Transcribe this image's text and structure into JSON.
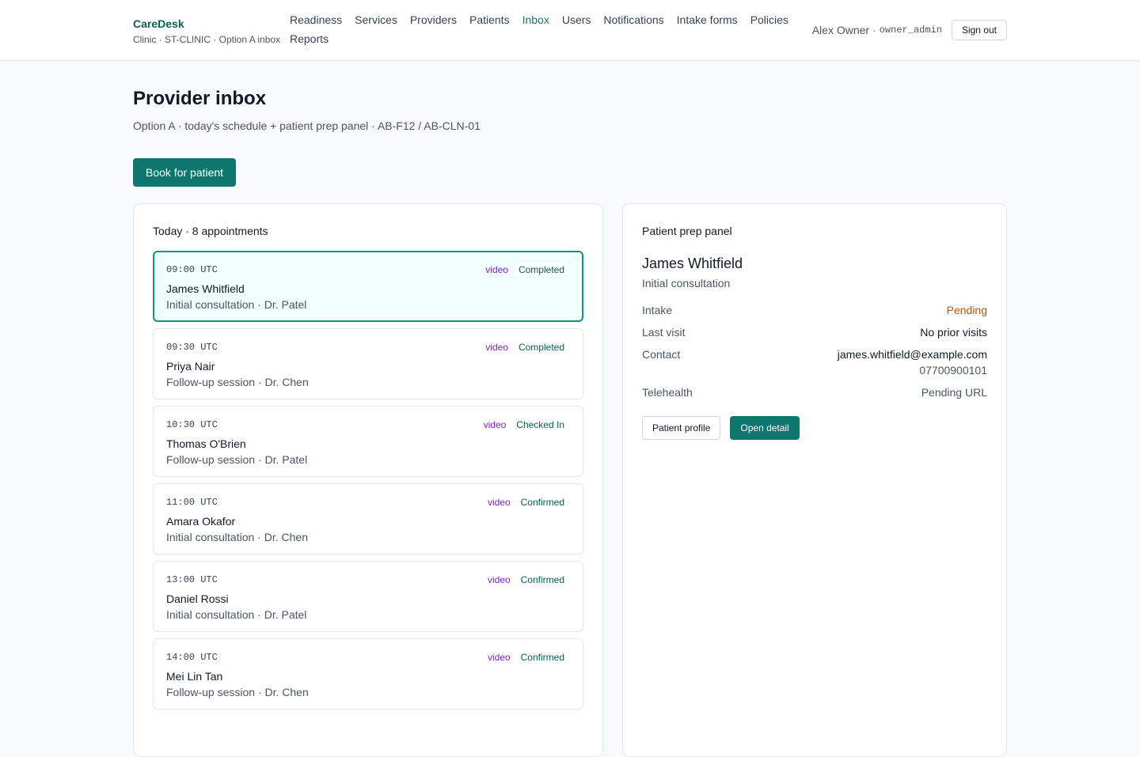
{
  "brand": {
    "name": "CareDesk",
    "subtitle": "Clinic · ST-CLINIC · Option A inbox"
  },
  "nav": {
    "items": [
      {
        "label": "Readiness",
        "active": false
      },
      {
        "label": "Services",
        "active": false
      },
      {
        "label": "Providers",
        "active": false
      },
      {
        "label": "Patients",
        "active": false
      },
      {
        "label": "Inbox",
        "active": true
      },
      {
        "label": "Users",
        "active": false
      },
      {
        "label": "Notifications",
        "active": false
      },
      {
        "label": "Intake forms",
        "active": false
      },
      {
        "label": "Policies",
        "active": false
      },
      {
        "label": "Reports",
        "active": false
      }
    ]
  },
  "user": {
    "name": "Alex Owner",
    "separator": "·",
    "role": "owner_admin",
    "signout_label": "Sign out"
  },
  "page": {
    "title": "Provider inbox",
    "subtitle": "Option A · today's schedule + patient prep panel · AB-F12 / AB-CLN-01",
    "book_label": "Book for patient"
  },
  "schedule": {
    "heading": "Today",
    "count_label": "· 8 appointments",
    "appointments": [
      {
        "time": "09:00 UTC",
        "mode": "video",
        "status": "Completed",
        "patient": "James Whitfield",
        "detail": "Initial consultation · Dr. Patel",
        "selected": true
      },
      {
        "time": "09:30 UTC",
        "mode": "video",
        "status": "Completed",
        "patient": "Priya Nair",
        "detail": "Follow-up session · Dr. Chen",
        "selected": false
      },
      {
        "time": "10:30 UTC",
        "mode": "video",
        "status": "Checked In",
        "patient": "Thomas O'Brien",
        "detail": "Follow-up session · Dr. Patel",
        "selected": false
      },
      {
        "time": "11:00 UTC",
        "mode": "video",
        "status": "Confirmed",
        "patient": "Amara Okafor",
        "detail": "Initial consultation · Dr. Chen",
        "selected": false
      },
      {
        "time": "13:00 UTC",
        "mode": "video",
        "status": "Confirmed",
        "patient": "Daniel Rossi",
        "detail": "Initial consultation · Dr. Patel",
        "selected": false
      },
      {
        "time": "14:00 UTC",
        "mode": "video",
        "status": "Confirmed",
        "patient": "Mei Lin Tan",
        "detail": "Follow-up session · Dr. Chen",
        "selected": false
      }
    ]
  },
  "prep": {
    "heading": "Patient prep panel",
    "patient_name": "James Whitfield",
    "appointment_type": "Initial consultation",
    "intake_label": "Intake",
    "intake_value": "Pending",
    "last_visit_label": "Last visit",
    "last_visit_value": "No prior visits",
    "contact_label": "Contact",
    "contact_email": "james.whitfield@example.com",
    "contact_phone": "07700900101",
    "telehealth_label": "Telehealth",
    "telehealth_value": "Pending URL",
    "profile_button": "Patient profile",
    "detail_button": "Open detail"
  },
  "colors": {
    "brand": "#0f5e52",
    "accent": "#0f766e",
    "pending": "#b45309",
    "video_tag": "#7e22ce",
    "status_tag": "#065f46"
  }
}
